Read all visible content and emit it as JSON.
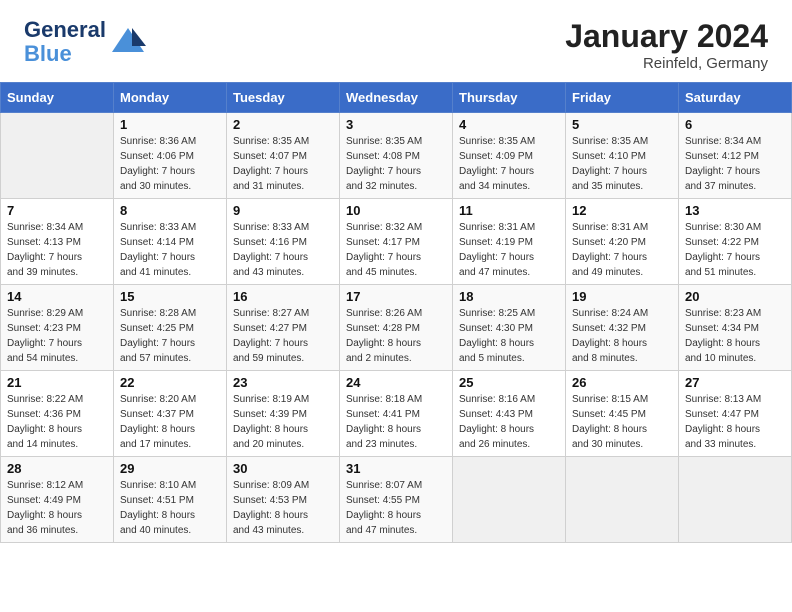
{
  "header": {
    "logo_line1": "General",
    "logo_line2": "Blue",
    "month": "January 2024",
    "location": "Reinfeld, Germany"
  },
  "weekdays": [
    "Sunday",
    "Monday",
    "Tuesday",
    "Wednesday",
    "Thursday",
    "Friday",
    "Saturday"
  ],
  "weeks": [
    [
      {
        "day": "",
        "info": ""
      },
      {
        "day": "1",
        "info": "Sunrise: 8:36 AM\nSunset: 4:06 PM\nDaylight: 7 hours\nand 30 minutes."
      },
      {
        "day": "2",
        "info": "Sunrise: 8:35 AM\nSunset: 4:07 PM\nDaylight: 7 hours\nand 31 minutes."
      },
      {
        "day": "3",
        "info": "Sunrise: 8:35 AM\nSunset: 4:08 PM\nDaylight: 7 hours\nand 32 minutes."
      },
      {
        "day": "4",
        "info": "Sunrise: 8:35 AM\nSunset: 4:09 PM\nDaylight: 7 hours\nand 34 minutes."
      },
      {
        "day": "5",
        "info": "Sunrise: 8:35 AM\nSunset: 4:10 PM\nDaylight: 7 hours\nand 35 minutes."
      },
      {
        "day": "6",
        "info": "Sunrise: 8:34 AM\nSunset: 4:12 PM\nDaylight: 7 hours\nand 37 minutes."
      }
    ],
    [
      {
        "day": "7",
        "info": "Sunrise: 8:34 AM\nSunset: 4:13 PM\nDaylight: 7 hours\nand 39 minutes."
      },
      {
        "day": "8",
        "info": "Sunrise: 8:33 AM\nSunset: 4:14 PM\nDaylight: 7 hours\nand 41 minutes."
      },
      {
        "day": "9",
        "info": "Sunrise: 8:33 AM\nSunset: 4:16 PM\nDaylight: 7 hours\nand 43 minutes."
      },
      {
        "day": "10",
        "info": "Sunrise: 8:32 AM\nSunset: 4:17 PM\nDaylight: 7 hours\nand 45 minutes."
      },
      {
        "day": "11",
        "info": "Sunrise: 8:31 AM\nSunset: 4:19 PM\nDaylight: 7 hours\nand 47 minutes."
      },
      {
        "day": "12",
        "info": "Sunrise: 8:31 AM\nSunset: 4:20 PM\nDaylight: 7 hours\nand 49 minutes."
      },
      {
        "day": "13",
        "info": "Sunrise: 8:30 AM\nSunset: 4:22 PM\nDaylight: 7 hours\nand 51 minutes."
      }
    ],
    [
      {
        "day": "14",
        "info": "Sunrise: 8:29 AM\nSunset: 4:23 PM\nDaylight: 7 hours\nand 54 minutes."
      },
      {
        "day": "15",
        "info": "Sunrise: 8:28 AM\nSunset: 4:25 PM\nDaylight: 7 hours\nand 57 minutes."
      },
      {
        "day": "16",
        "info": "Sunrise: 8:27 AM\nSunset: 4:27 PM\nDaylight: 7 hours\nand 59 minutes."
      },
      {
        "day": "17",
        "info": "Sunrise: 8:26 AM\nSunset: 4:28 PM\nDaylight: 8 hours\nand 2 minutes."
      },
      {
        "day": "18",
        "info": "Sunrise: 8:25 AM\nSunset: 4:30 PM\nDaylight: 8 hours\nand 5 minutes."
      },
      {
        "day": "19",
        "info": "Sunrise: 8:24 AM\nSunset: 4:32 PM\nDaylight: 8 hours\nand 8 minutes."
      },
      {
        "day": "20",
        "info": "Sunrise: 8:23 AM\nSunset: 4:34 PM\nDaylight: 8 hours\nand 10 minutes."
      }
    ],
    [
      {
        "day": "21",
        "info": "Sunrise: 8:22 AM\nSunset: 4:36 PM\nDaylight: 8 hours\nand 14 minutes."
      },
      {
        "day": "22",
        "info": "Sunrise: 8:20 AM\nSunset: 4:37 PM\nDaylight: 8 hours\nand 17 minutes."
      },
      {
        "day": "23",
        "info": "Sunrise: 8:19 AM\nSunset: 4:39 PM\nDaylight: 8 hours\nand 20 minutes."
      },
      {
        "day": "24",
        "info": "Sunrise: 8:18 AM\nSunset: 4:41 PM\nDaylight: 8 hours\nand 23 minutes."
      },
      {
        "day": "25",
        "info": "Sunrise: 8:16 AM\nSunset: 4:43 PM\nDaylight: 8 hours\nand 26 minutes."
      },
      {
        "day": "26",
        "info": "Sunrise: 8:15 AM\nSunset: 4:45 PM\nDaylight: 8 hours\nand 30 minutes."
      },
      {
        "day": "27",
        "info": "Sunrise: 8:13 AM\nSunset: 4:47 PM\nDaylight: 8 hours\nand 33 minutes."
      }
    ],
    [
      {
        "day": "28",
        "info": "Sunrise: 8:12 AM\nSunset: 4:49 PM\nDaylight: 8 hours\nand 36 minutes."
      },
      {
        "day": "29",
        "info": "Sunrise: 8:10 AM\nSunset: 4:51 PM\nDaylight: 8 hours\nand 40 minutes."
      },
      {
        "day": "30",
        "info": "Sunrise: 8:09 AM\nSunset: 4:53 PM\nDaylight: 8 hours\nand 43 minutes."
      },
      {
        "day": "31",
        "info": "Sunrise: 8:07 AM\nSunset: 4:55 PM\nDaylight: 8 hours\nand 47 minutes."
      },
      {
        "day": "",
        "info": ""
      },
      {
        "day": "",
        "info": ""
      },
      {
        "day": "",
        "info": ""
      }
    ]
  ]
}
